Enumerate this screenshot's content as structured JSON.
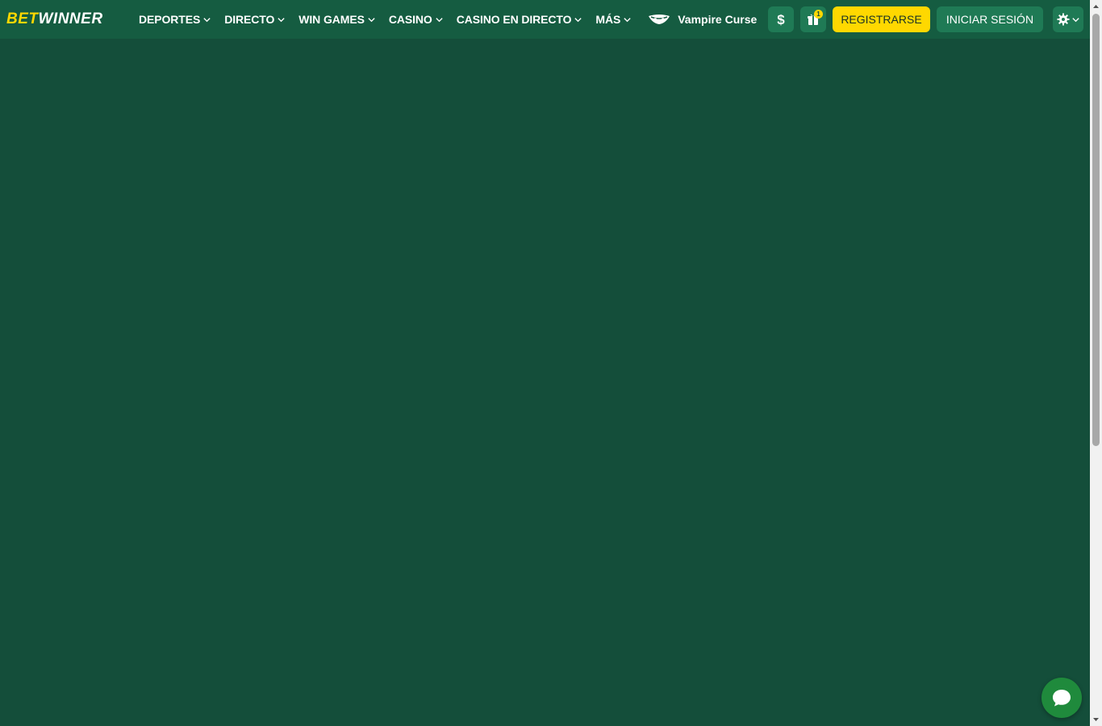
{
  "brand": {
    "logo_part1": "BET",
    "logo_part2": "WINNER"
  },
  "nav": {
    "items": [
      {
        "label": "DEPORTES"
      },
      {
        "label": "DIRECTO"
      },
      {
        "label": "WIN GAMES"
      },
      {
        "label": "CASINO"
      },
      {
        "label": "CASINO EN DIRECTO"
      },
      {
        "label": "MÁS"
      }
    ],
    "promo_label": "Vampire Curse"
  },
  "header": {
    "gift_badge_count": "1",
    "register_label": "REGISTRARSE",
    "login_label": "INICIAR SESIÓN"
  },
  "icons": {
    "deposit": "dollar-icon",
    "gift": "gift-icon",
    "settings": "gear-icon",
    "chat": "chat-icon"
  },
  "colors": {
    "background": "#144e3a",
    "topbar": "#155c41",
    "accent": "#ffd800",
    "button": "#1f7a55",
    "chat": "#1f8a3c"
  }
}
